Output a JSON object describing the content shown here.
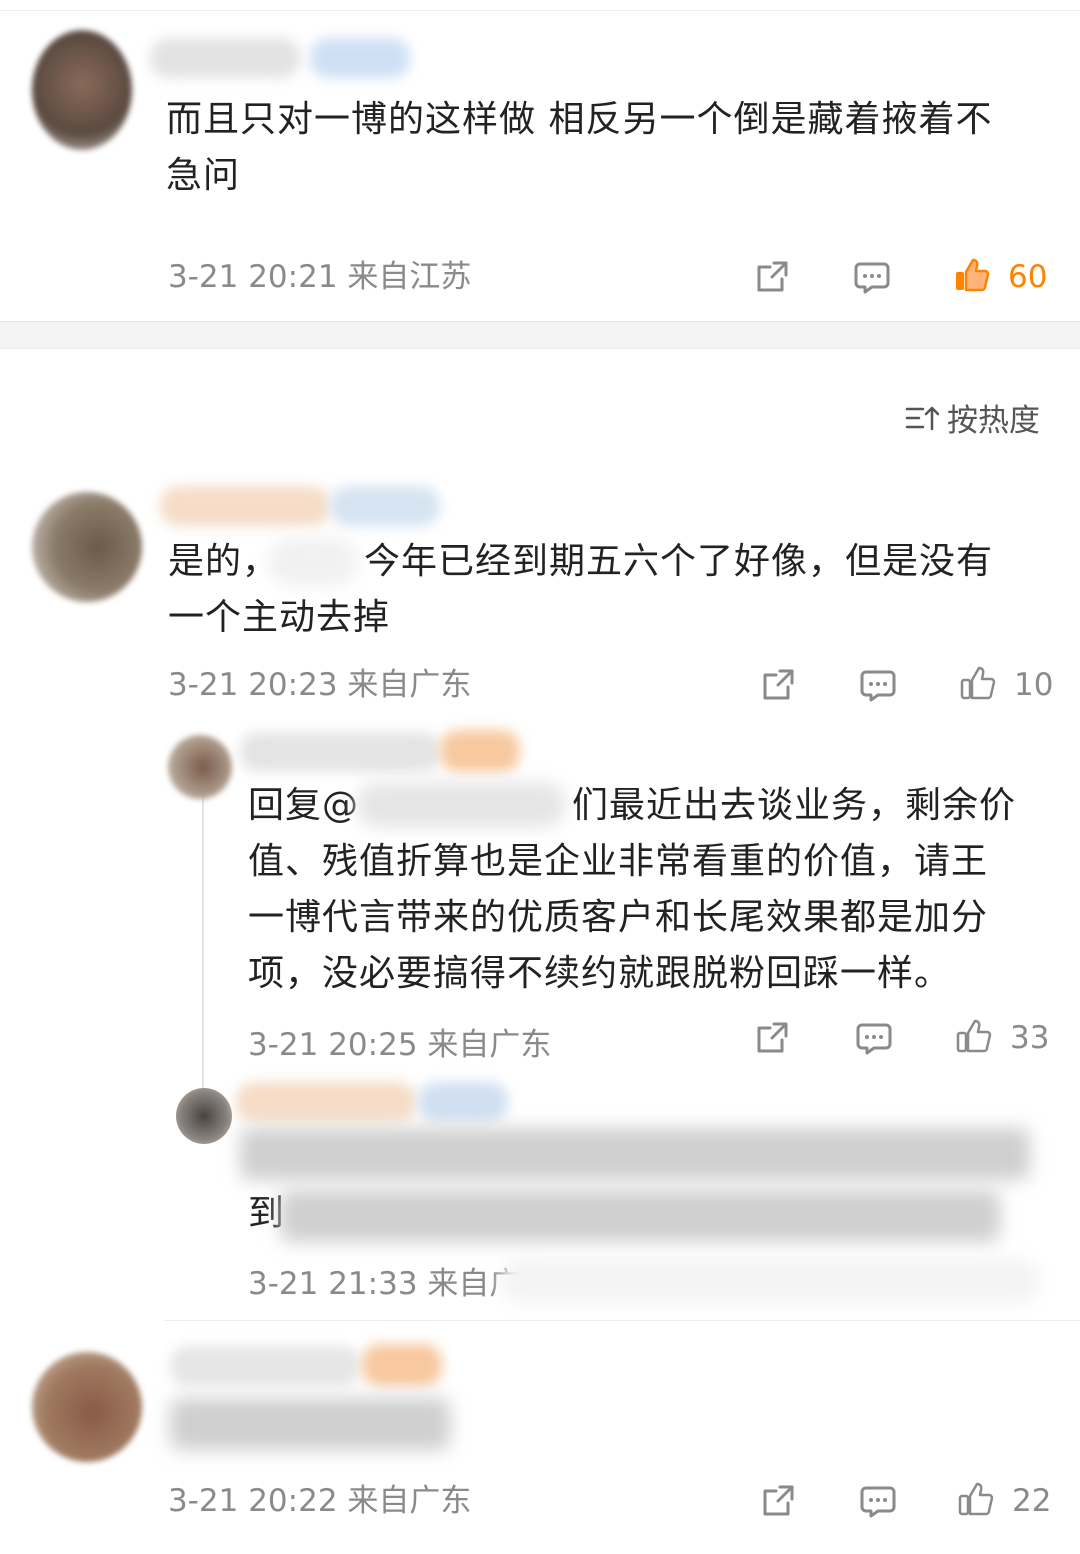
{
  "comment1": {
    "text_line1": "而且只对一博的这样做 相反另一个倒是藏着掖着不",
    "text_line2": "急问",
    "meta": "3-21 20:21 来自江苏",
    "likes": "60",
    "liked": true
  },
  "sort": {
    "label": "按热度",
    "icon": "sort-icon"
  },
  "comment2": {
    "text_line1_a": "是的，",
    "text_line1_b": "今年已经到期五六个了好像，但是没有",
    "text_line2": "一个主动去掉",
    "meta": "3-21 20:23 来自广东",
    "likes": "10"
  },
  "reply1": {
    "prefix": "回复@",
    "line1_tail": "们最近出去谈业务，剩余价",
    "line2": "值、残值折算也是企业非常看重的价值，请王",
    "line3": "一博代言带来的优质客户和长尾效果都是加分",
    "line4": "项，没必要搞得不续约就跟脱粉回踩一样。",
    "meta": "3-21 20:25 来自广东",
    "likes": "33"
  },
  "reply2": {
    "text_start": "到",
    "meta": "3-21 21:33 来自广"
  },
  "comment3": {
    "meta": "3-21 20:22 来自广东",
    "likes": "22"
  },
  "colors": {
    "accent": "#ff8200",
    "meta": "#8a8a8a",
    "text": "#222222"
  }
}
